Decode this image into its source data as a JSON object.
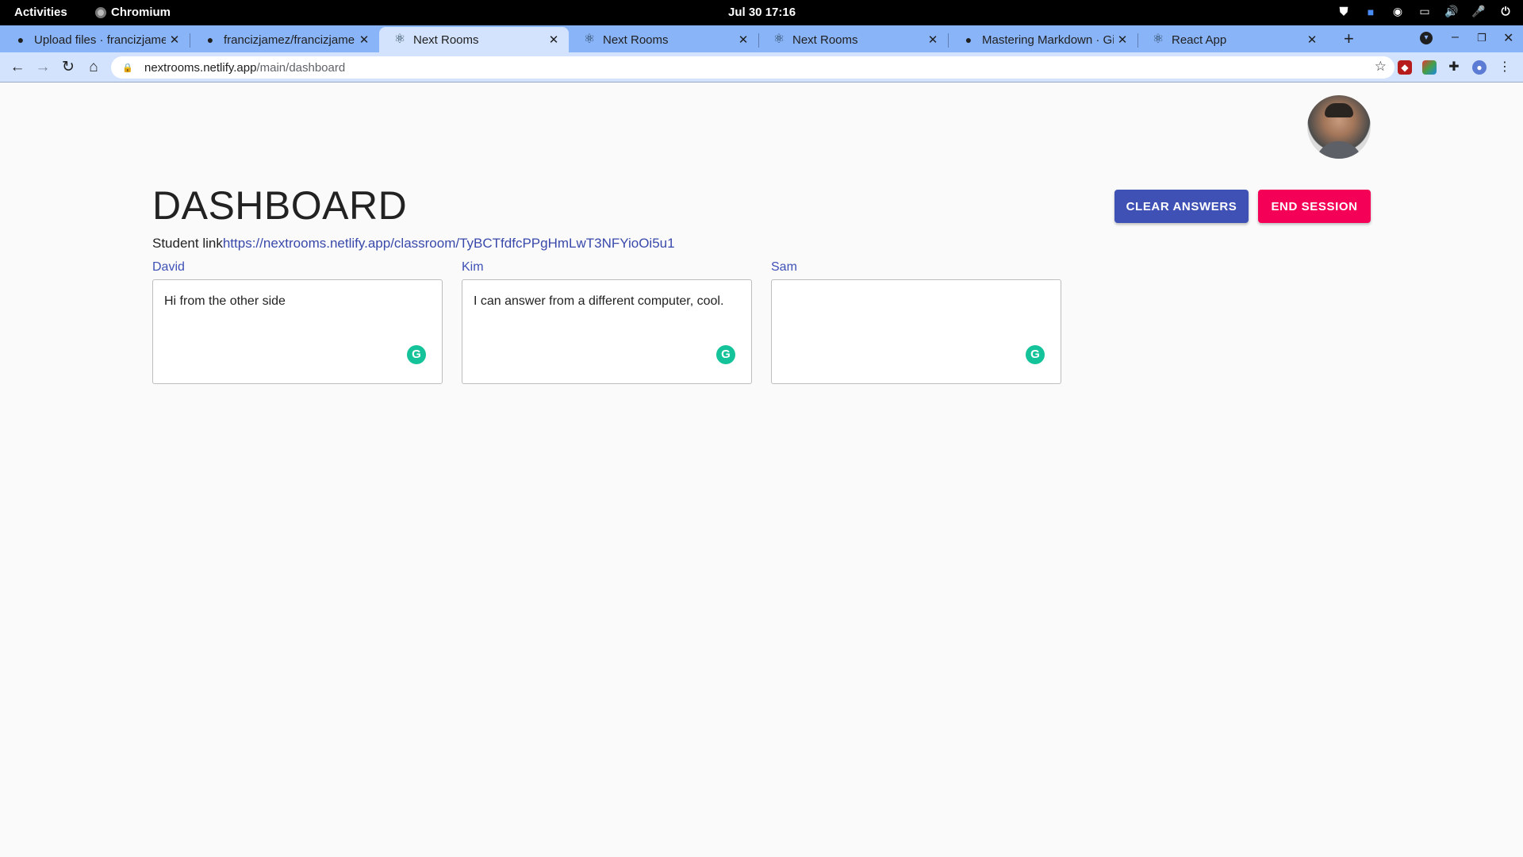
{
  "system": {
    "activities": "Activities",
    "app_name": "Chromium",
    "clock": "Jul 30  17:16"
  },
  "tabs": [
    {
      "title": "Upload files · francizjame",
      "icon": "github-icon",
      "active": false
    },
    {
      "title": "francizjamez/francizjame",
      "icon": "github-icon",
      "active": false
    },
    {
      "title": "Next Rooms",
      "icon": "react-icon",
      "active": true
    },
    {
      "title": "Next Rooms",
      "icon": "react-icon",
      "active": false
    },
    {
      "title": "Next Rooms",
      "icon": "react-icon",
      "active": false
    },
    {
      "title": "Mastering Markdown · Gi",
      "icon": "github-icon",
      "active": false
    },
    {
      "title": "React App",
      "icon": "react-icon",
      "active": false
    }
  ],
  "address": {
    "host": "nextrooms.netlify.app",
    "path": "/main/dashboard"
  },
  "page": {
    "title": "DASHBOARD",
    "clear_label": "CLEAR ANSWERS",
    "end_label": "END SESSION",
    "student_label": "Student link",
    "student_url": "https://nextrooms.netlify.app/classroom/TyBCTfdfcPPgHmLwT3NFYioOi5u1",
    "students": [
      {
        "name": "David",
        "answer": "Hi from the other side"
      },
      {
        "name": "Kim",
        "answer": "I can answer from a different computer, cool."
      },
      {
        "name": "Sam",
        "answer": ""
      }
    ]
  },
  "colors": {
    "primary": "#3f51b5",
    "secondary": "#f50057",
    "grammarly": "#15c39a"
  }
}
